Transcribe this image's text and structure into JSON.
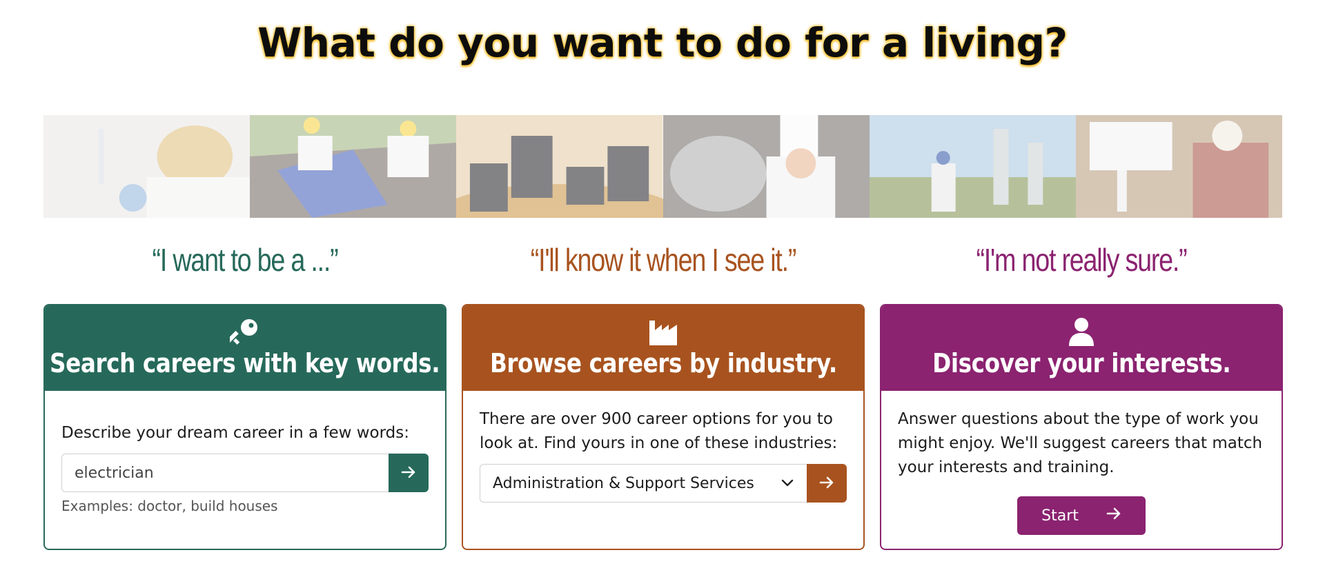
{
  "page": {
    "title": "What do you want to do for a living?"
  },
  "quotes": {
    "q1": "“I want to be a ...”",
    "q2": "“I'll know it when I see it.”",
    "q3": "“I'm not really sure.”"
  },
  "search_card": {
    "title": "Search careers with key words.",
    "icon": "key-icon",
    "prompt": "Describe your dream career in a few words:",
    "input_value": "electrician",
    "hint": "Examples: doctor, build houses",
    "accent": "#26695a"
  },
  "browse_card": {
    "title": "Browse careers by industry.",
    "icon": "industry-icon",
    "description": "There are over 900 career options for you to look at. Find yours in one of these industries:",
    "selected_industry": "Administration & Support Services",
    "accent": "#a8531f"
  },
  "discover_card": {
    "title": "Discover your interests.",
    "icon": "user-icon",
    "description": "Answer questions about the type of work you might enjoy. We'll suggest careers that match your interests and training.",
    "start_label": "Start",
    "accent": "#8b2370"
  }
}
